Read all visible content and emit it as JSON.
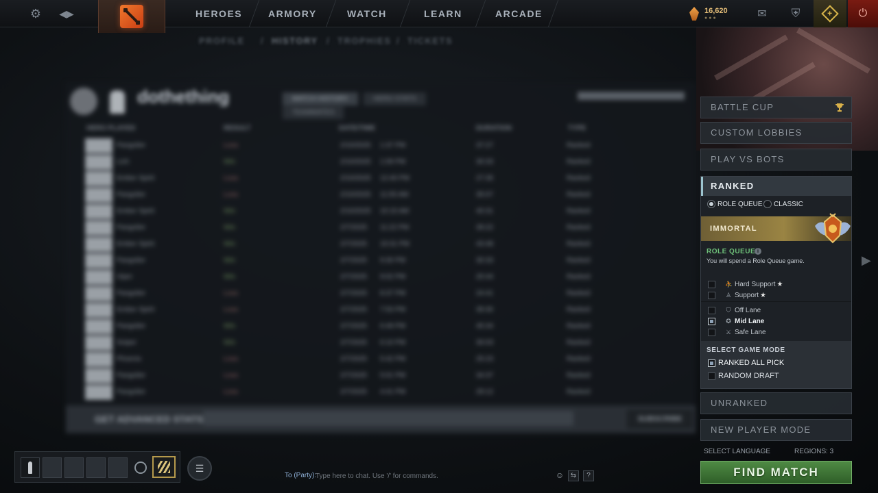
{
  "topbar": {
    "nav": [
      "HEROES",
      "ARMORY",
      "WATCH",
      "LEARN",
      "ARCADE"
    ],
    "gold_value": "16,620",
    "gold_dots": "●●●"
  },
  "subnav": [
    "PROFILE",
    "HISTORY",
    "TROPHIES",
    "TICKETS"
  ],
  "history": {
    "player_name": "dothething",
    "tabs": [
      "MATCH HISTORY",
      "HERO STATS",
      "TEAMMATES"
    ],
    "columns": [
      "HERO PLAYED",
      "RESULT",
      "DATE/TIME",
      "DURATION",
      "TYPE"
    ],
    "rows": [
      {
        "hero": "Pangolier",
        "result": "Loss",
        "date": "2/10/2025",
        "time": "1:37 PM",
        "duration": "37:27",
        "type": "Ranked"
      },
      {
        "hero": "Lich",
        "result": "Win",
        "date": "2/10/2025",
        "time": "1:09 PM",
        "duration": "30:33",
        "type": "Ranked"
      },
      {
        "hero": "Ember Spirit",
        "result": "Loss",
        "date": "2/10/2025",
        "time": "12:40 PM",
        "duration": "27:35",
        "type": "Ranked"
      },
      {
        "hero": "Pangolier",
        "result": "Loss",
        "date": "2/10/2025",
        "time": "11:55 AM",
        "duration": "35:07",
        "type": "Ranked"
      },
      {
        "hero": "Ember Spirit",
        "result": "Win",
        "date": "2/10/2025",
        "time": "10:15 AM",
        "duration": "40:31",
        "type": "Ranked"
      },
      {
        "hero": "Pangolier",
        "result": "Win",
        "date": "2/7/2025",
        "time": "11:22 PM",
        "duration": "39:22",
        "type": "Ranked"
      },
      {
        "hero": "Ember Spirit",
        "result": "Win",
        "date": "2/7/2025",
        "time": "10:31 PM",
        "duration": "43:48",
        "type": "Ranked"
      },
      {
        "hero": "Pangolier",
        "result": "Win",
        "date": "2/7/2025",
        "time": "9:30 PM",
        "duration": "30:33",
        "type": "Ranked"
      },
      {
        "hero": "Viper",
        "result": "Win",
        "date": "2/7/2025",
        "time": "9:02 PM",
        "duration": "20:44",
        "type": "Ranked"
      },
      {
        "hero": "Pangolier",
        "result": "Loss",
        "date": "2/7/2025",
        "time": "8:37 PM",
        "duration": "24:41",
        "type": "Ranked"
      },
      {
        "hero": "Ember Spirit",
        "result": "Loss",
        "date": "2/7/2025",
        "time": "7:53 PM",
        "duration": "39:30",
        "type": "Ranked"
      },
      {
        "hero": "Pangolier",
        "result": "Win",
        "date": "2/7/2025",
        "time": "6:49 PM",
        "duration": "45:34",
        "type": "Ranked"
      },
      {
        "hero": "Sniper",
        "result": "Win",
        "date": "2/7/2025",
        "time": "6:10 PM",
        "duration": "30:03",
        "type": "Ranked"
      },
      {
        "hero": "Phoenix",
        "result": "Loss",
        "date": "2/7/2025",
        "time": "5:42 PM",
        "duration": "25:23",
        "type": "Ranked"
      },
      {
        "hero": "Pangolier",
        "result": "Loss",
        "date": "2/7/2025",
        "time": "5:01 PM",
        "duration": "34:37",
        "type": "Ranked"
      },
      {
        "hero": "Pangolier",
        "result": "Loss",
        "date": "2/7/2025",
        "time": "4:41 PM",
        "duration": "29:12",
        "type": "Ranked"
      }
    ],
    "banner_title": "GET ADVANCED STATS",
    "banner_button": "SUBSCRIBE"
  },
  "play": {
    "battle_cup": "BATTLE CUP",
    "custom_lobbies": "CUSTOM LOBBIES",
    "play_vs_bots": "PLAY VS BOTS",
    "ranked": "RANKED",
    "role_queue_radio": "ROLE QUEUE",
    "classic_radio": "CLASSIC",
    "rank_name": "IMMORTAL",
    "role_queue_title": "ROLE QUEUE",
    "role_queue_info": "i",
    "role_queue_sub": "You will spend a Role Queue game.",
    "roles": [
      {
        "label": "Hard Support",
        "star": "★",
        "checked": false
      },
      {
        "label": "Support",
        "star": "★",
        "checked": false
      },
      {
        "label": "Off Lane",
        "star": "",
        "checked": false
      },
      {
        "label": "Mid Lane",
        "star": "",
        "checked": true
      },
      {
        "label": "Safe Lane",
        "star": "",
        "checked": false
      }
    ],
    "select_game_mode": "SELECT GAME MODE",
    "modes": [
      {
        "label": "RANKED ALL PICK",
        "checked": true
      },
      {
        "label": "RANDOM DRAFT",
        "checked": false
      }
    ],
    "unranked": "UNRANKED",
    "new_player_mode": "NEW PLAYER MODE",
    "select_language": "SELECT LANGUAGE",
    "regions": "REGIONS: 3",
    "find_match": "FIND MATCH"
  },
  "chat": {
    "label": "To (Party):",
    "placeholder": "Type here to chat. Use '/' for commands.",
    "help": "?"
  },
  "colors": {
    "find_match": "#4f8a44",
    "role_queue_green": "#6fc27a",
    "immortal_gold": "#9a8443",
    "power_red": "#7a1b12"
  }
}
